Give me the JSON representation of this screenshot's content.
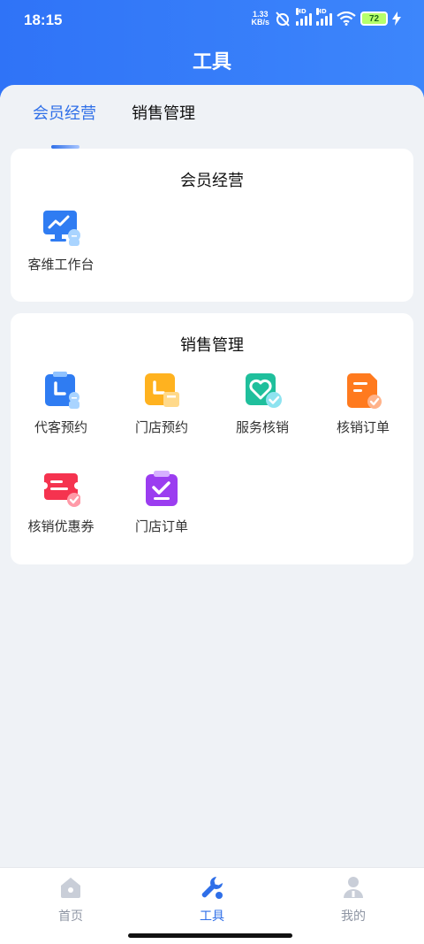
{
  "status_bar": {
    "time": "18:15",
    "net_speed_value": "1.33",
    "net_speed_unit": "KB/s",
    "signal_tag": "HD",
    "battery_level": "72"
  },
  "header": {
    "title": "工具"
  },
  "tabs": [
    {
      "label": "会员经营",
      "active": true
    },
    {
      "label": "销售管理",
      "active": false
    }
  ],
  "sections": [
    {
      "title": "会员经营",
      "items": [
        {
          "label": "客维工作台",
          "icon": "monitor-chart-icon"
        }
      ]
    },
    {
      "title": "销售管理",
      "items": [
        {
          "label": "代客预约",
          "icon": "clipboard-clock-icon"
        },
        {
          "label": "门店预约",
          "icon": "store-clock-icon"
        },
        {
          "label": "服务核销",
          "icon": "heart-check-icon"
        },
        {
          "label": "核销订单",
          "icon": "order-document-icon"
        },
        {
          "label": "核销优惠券",
          "icon": "coupon-check-icon"
        },
        {
          "label": "门店订单",
          "icon": "clipboard-check-icon"
        }
      ]
    }
  ],
  "bottom_nav": [
    {
      "label": "首页",
      "icon": "home-icon",
      "active": false
    },
    {
      "label": "工具",
      "icon": "wrench-icon",
      "active": true
    },
    {
      "label": "我的",
      "icon": "user-icon",
      "active": false
    }
  ],
  "colors": {
    "accent": "#2f6fe8",
    "header_start": "#2f73f7",
    "header_end": "#3d86fb",
    "background": "#eff2f6",
    "nav_inactive": "#8e95a3"
  }
}
